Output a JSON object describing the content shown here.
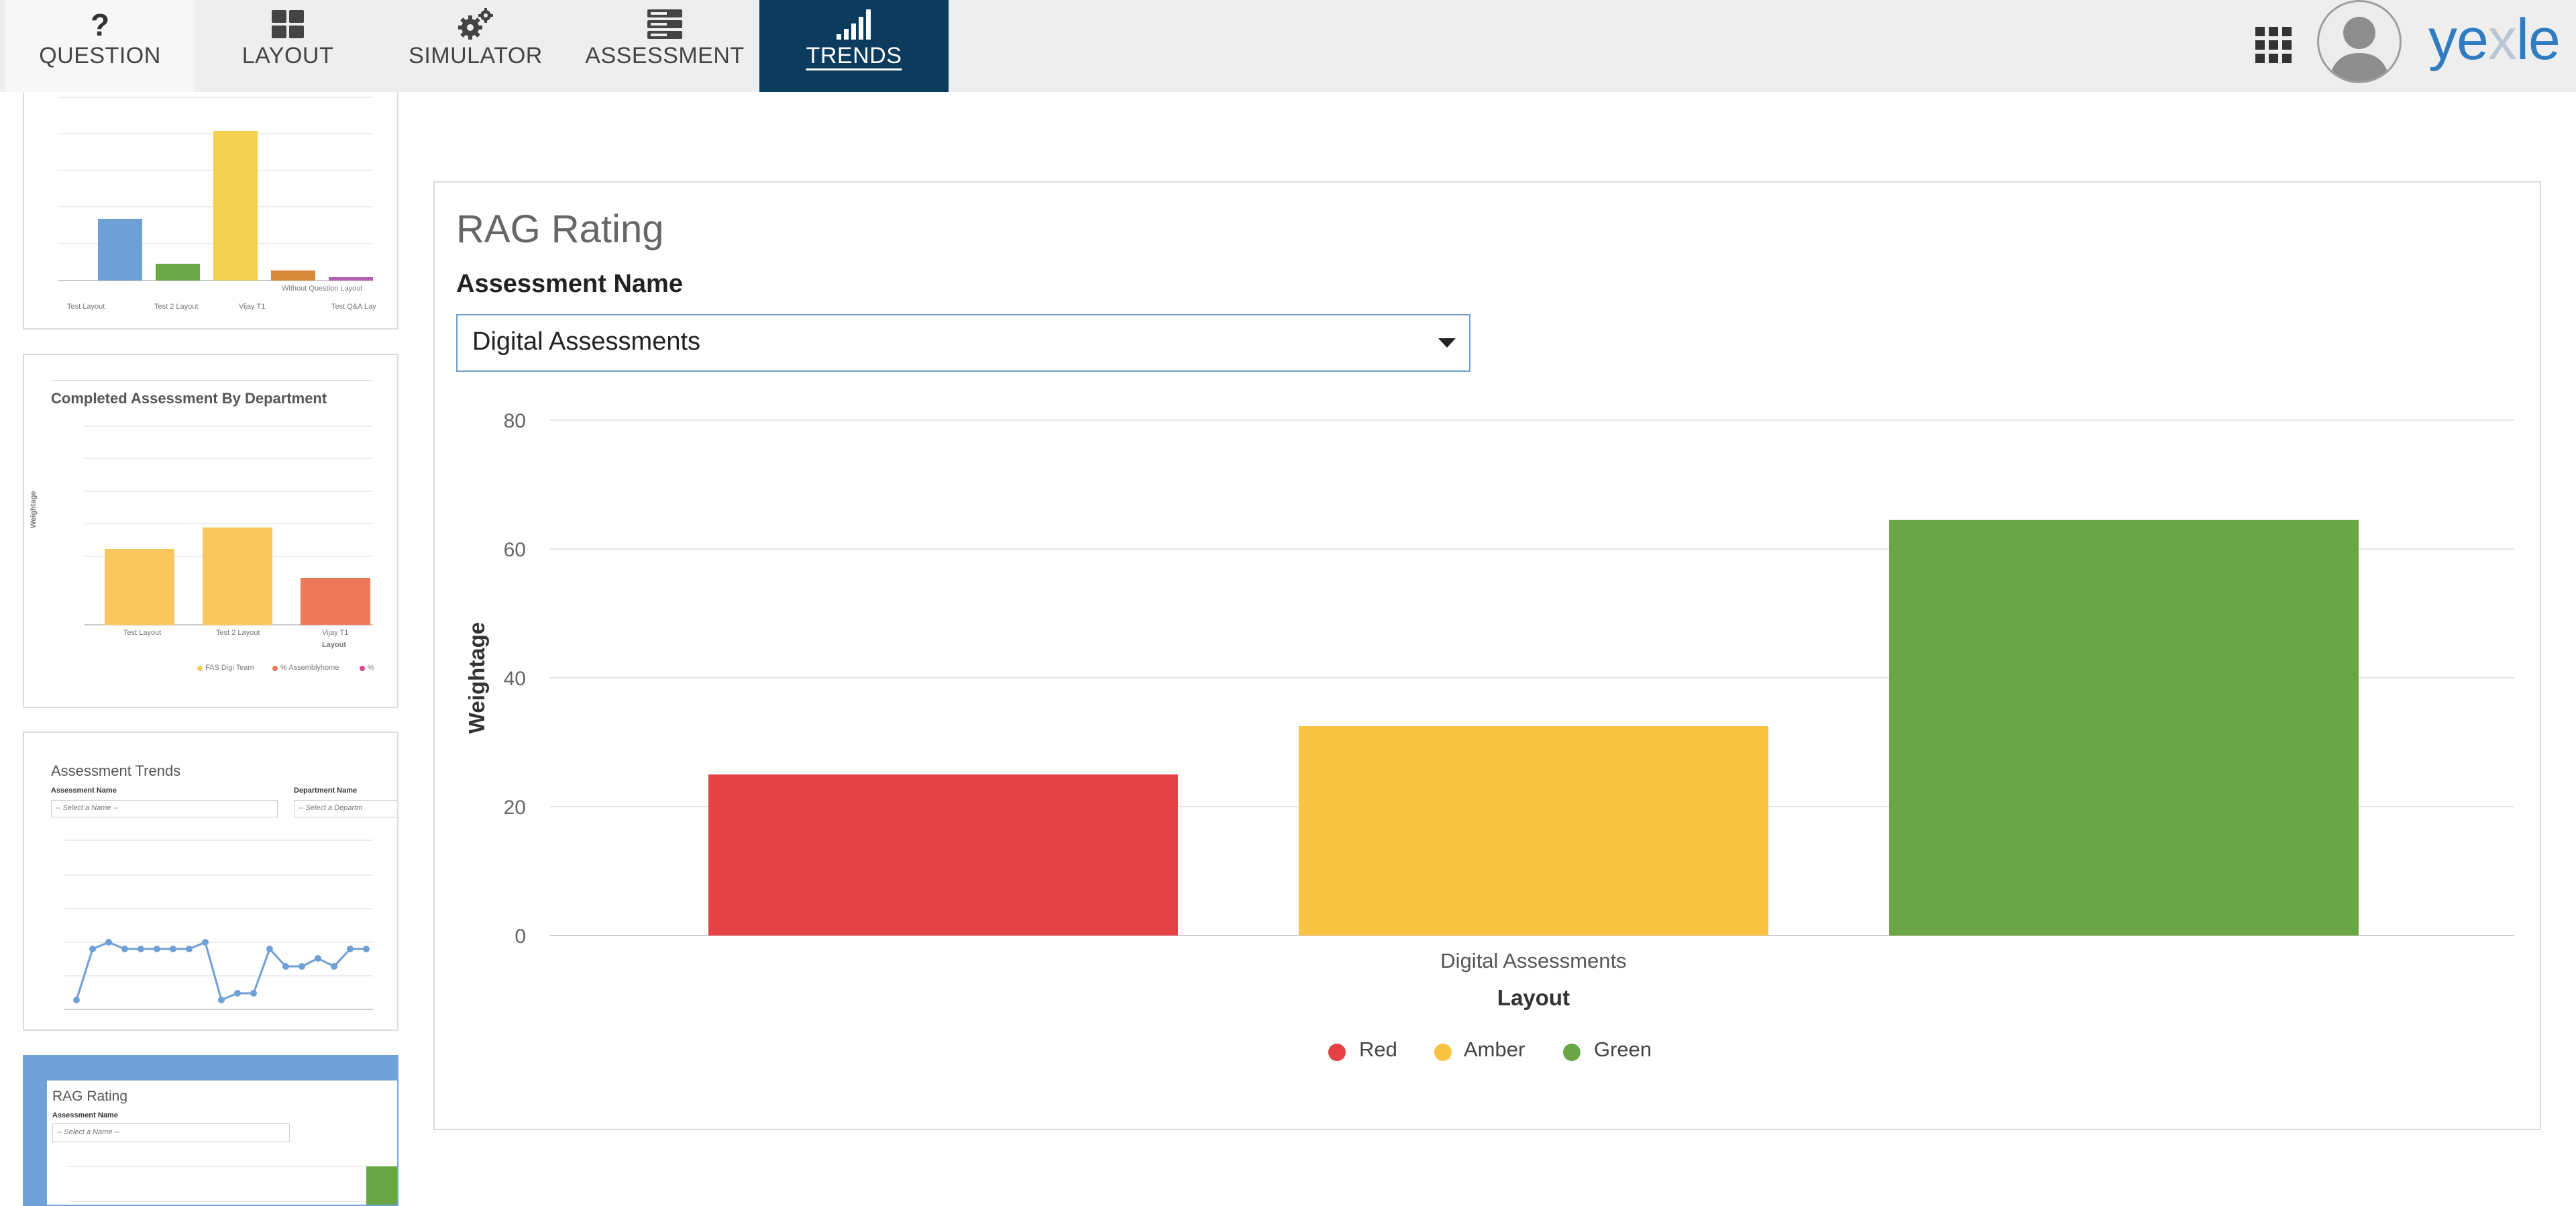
{
  "nav": {
    "tabs": [
      {
        "label": "QUESTION",
        "icon": "question-icon"
      },
      {
        "label": "LAYOUT",
        "icon": "layout-grid-icon"
      },
      {
        "label": "SIMULATOR",
        "icon": "gears-icon"
      },
      {
        "label": "ASSESSMENT",
        "icon": "server-icon"
      },
      {
        "label": "TRENDS",
        "icon": "signal-bars-icon"
      }
    ],
    "active_tab": "TRENDS"
  },
  "header": {
    "logo_text": "yexle",
    "apps_icon": "apps-grid-icon",
    "avatar_icon": "user-avatar-icon"
  },
  "thumbnails": [
    {
      "title": "",
      "legend": [
        "Test Layout",
        "Test 2 Layout",
        "Vijay T1",
        "Test Q&A Lay"
      ],
      "annotation": "Without Question Layout"
    },
    {
      "title": "Completed Assessment By Department",
      "ylabel": "Weightage",
      "xlabel": "Layout",
      "categories": [
        "Test Layout",
        "Test 2 Layout",
        "Vijay T1"
      ],
      "legend": [
        "FAS Digi Team",
        "% Assemblyhome",
        "%"
      ]
    },
    {
      "title": "Assessment Trends",
      "field1_label": "Assessment Name",
      "field1_placeholder": "-- Select a Name --",
      "field2_label": "Department Name",
      "field2_placeholder": "-- Select a Departm"
    },
    {
      "title": "RAG Rating",
      "field_label": "Assessment Name",
      "placeholder": "-- Select a Name --"
    }
  ],
  "main": {
    "title": "RAG Rating",
    "field_label": "Assessment Name",
    "selected_assessment": "Digital Assessments"
  },
  "colors": {
    "nav_active": "#0c3b5e",
    "red": "#e44247",
    "amber": "#f9c342",
    "green": "#6aa646",
    "thumb_selected": "#6fa3d8"
  },
  "chart_data": {
    "type": "bar",
    "categories": [
      "Digital Assessments"
    ],
    "series": [
      {
        "name": "Red",
        "values": [
          25
        ],
        "color": "#e44247"
      },
      {
        "name": "Amber",
        "values": [
          32.5
        ],
        "color": "#f9c342"
      },
      {
        "name": "Green",
        "values": [
          64.5
        ],
        "color": "#6aa646"
      }
    ],
    "xlabel": "Layout",
    "ylabel": "Weightage",
    "ylim": [
      0,
      80
    ],
    "yticks": [
      0,
      20,
      40,
      60,
      80
    ],
    "grid": true,
    "legend_position": "bottom"
  }
}
